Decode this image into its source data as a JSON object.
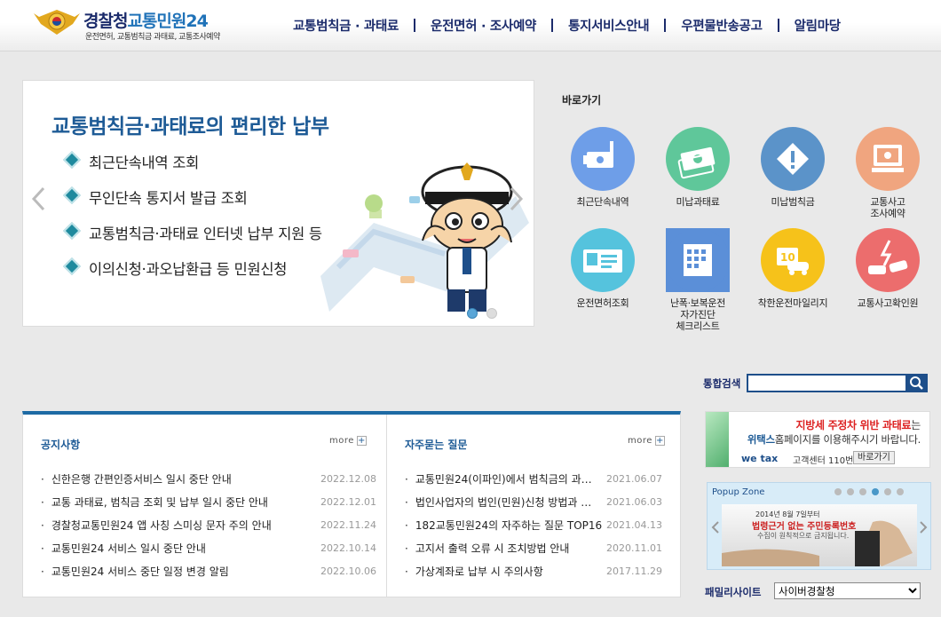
{
  "header": {
    "brand_part1": "경찰청",
    "brand_part2": "교통민원24",
    "subtitle": "운전면허, 교통범칙금 과태료, 교통조사예약",
    "nav": [
      "교통범칙금 · 과태료",
      "운전면허 · 조사예약",
      "통지서비스안내",
      "우편물반송공고",
      "알림마당"
    ]
  },
  "banner": {
    "title": "교통범칙금·과태료의 편리한 납부",
    "items": [
      "최근단속내역 조회",
      "무인단속 통지서 발급 조회",
      "교통범칙금·과태료 인터넷 납부 지원 등",
      "이의신청·과오납환급 등 민원신청"
    ],
    "slide_count": 2,
    "active_slide": 1
  },
  "quick": {
    "title": "바로가기",
    "items": [
      {
        "label": "최근단속내역",
        "icon": "camera-icon",
        "color": "#6e9ee8"
      },
      {
        "label": "미납과태료",
        "icon": "money-icon",
        "color": "#5fc79a"
      },
      {
        "label": "미납범칙금",
        "icon": "warning-icon",
        "color": "#5b93c9"
      },
      {
        "label": "교통사고\n조사예약",
        "icon": "computer-icon",
        "color": "#f0a57f"
      },
      {
        "label": "운전면허조회",
        "icon": "license-icon",
        "color": "#55c3dd"
      },
      {
        "label": "난폭·보복운전\n자가진단\n체크리스트",
        "icon": "checklist-icon",
        "color": "#5b8fd8"
      },
      {
        "label": "착한운전마일리지",
        "icon": "mileage-icon",
        "color": "#f6c21a"
      },
      {
        "label": "교통사고확인원",
        "icon": "accident-icon",
        "color": "#ec6d6d"
      }
    ]
  },
  "search": {
    "label": "통합검색",
    "value": ""
  },
  "notice": {
    "title": "공지사항",
    "more": "more",
    "rows": [
      {
        "title": "신한은행 간편인증서비스 일시 중단 안내",
        "date": "2022.12.08"
      },
      {
        "title": "교통 과태료, 범칙금 조회 및 납부 일시 중단 안내",
        "date": "2022.12.01"
      },
      {
        "title": "경찰청교통민원24 앱 사칭 스미싱 문자 주의 안내",
        "date": "2022.11.24"
      },
      {
        "title": "교통민원24 서비스 일시 중단 안내",
        "date": "2022.10.14"
      },
      {
        "title": "교통민원24 서비스 중단 일정 변경 알림",
        "date": "2022.10.06"
      }
    ]
  },
  "faq": {
    "title": "자주묻는 질문",
    "more": "more",
    "rows": [
      {
        "title": "교통민원24(이파인)에서 범칙금의 과…",
        "date": "2021.06.07"
      },
      {
        "title": "법인사업자의 법인(민원)신청 방법과 …",
        "date": "2021.06.03"
      },
      {
        "title": "182교통민원24의 자주하는 질문 TOP16",
        "date": "2021.04.13"
      },
      {
        "title": "고지서 출력 오류 시 조치방법 안내",
        "date": "2020.11.01"
      },
      {
        "title": "가상계좌로 납부 시 주의사항",
        "date": "2017.11.29"
      }
    ]
  },
  "wetax": {
    "line1_highlight": "지방세 주정차 위반 과태료",
    "line1_rest": "는",
    "line2_highlight": "위택스",
    "line2_rest": "홈페이지를 이용해주시기 바랍니다.",
    "logo": "we tax",
    "callcenter": "고객센터 110번",
    "go": "바로가기"
  },
  "popup": {
    "title": "Popup Zone",
    "dot_count": 6,
    "active_dot": 4,
    "line1": "2014년 8월 7일부터",
    "line2": "법령근거 없는 주민등록번호",
    "line3": "수집이 원칙적으로 금지됩니다."
  },
  "family": {
    "label": "패밀리사이트",
    "selected": "사이버경찰청"
  }
}
